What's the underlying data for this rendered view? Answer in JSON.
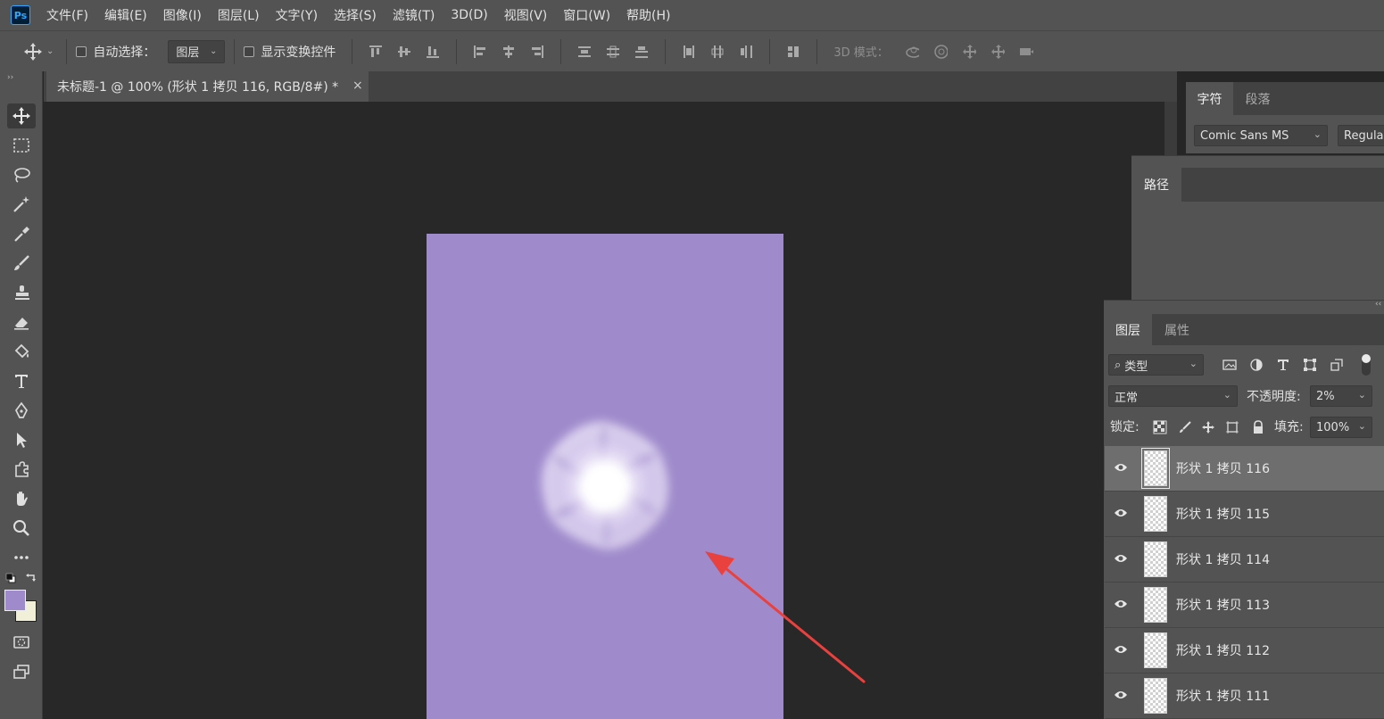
{
  "app": {
    "logo_text": "Ps"
  },
  "menu": [
    "文件(F)",
    "编辑(E)",
    "图像(I)",
    "图层(L)",
    "文字(Y)",
    "选择(S)",
    "滤镜(T)",
    "3D(D)",
    "视图(V)",
    "窗口(W)",
    "帮助(H)"
  ],
  "options": {
    "auto_select_label": "自动选择：",
    "auto_select_target": "图层",
    "show_transform_label": "显示变换控件",
    "mode_3d_label": "3D 模式："
  },
  "document": {
    "tab_title": "未标题-1 @ 100% (形状 1 拷贝 116, RGB/8#) *",
    "close_glyph": "×",
    "canvas_color": "#9f8bcb"
  },
  "colors": {
    "foreground": "#9f8bcb",
    "background": "#f2efd9",
    "annotation_arrow": "#e8413e"
  },
  "character_panel": {
    "tabs": [
      "字符",
      "段落"
    ],
    "font_family": "Comic Sans MS",
    "font_style": "Regular"
  },
  "paths_panel": {
    "tab": "路径"
  },
  "layers_panel": {
    "tabs": [
      "图层",
      "属性"
    ],
    "filter_label": "类型",
    "blend_mode": "正常",
    "opacity_label": "不透明度:",
    "opacity_value": "2%",
    "lock_label": "锁定:",
    "fill_label": "填充:",
    "fill_value": "100%",
    "layers": [
      {
        "name": "形状 1 拷贝 116",
        "selected": true
      },
      {
        "name": "形状 1 拷贝 115",
        "selected": false
      },
      {
        "name": "形状 1 拷贝 114",
        "selected": false
      },
      {
        "name": "形状 1 拷贝 113",
        "selected": false
      },
      {
        "name": "形状 1 拷贝 112",
        "selected": false
      },
      {
        "name": "形状 1 拷贝 111",
        "selected": false
      }
    ]
  }
}
